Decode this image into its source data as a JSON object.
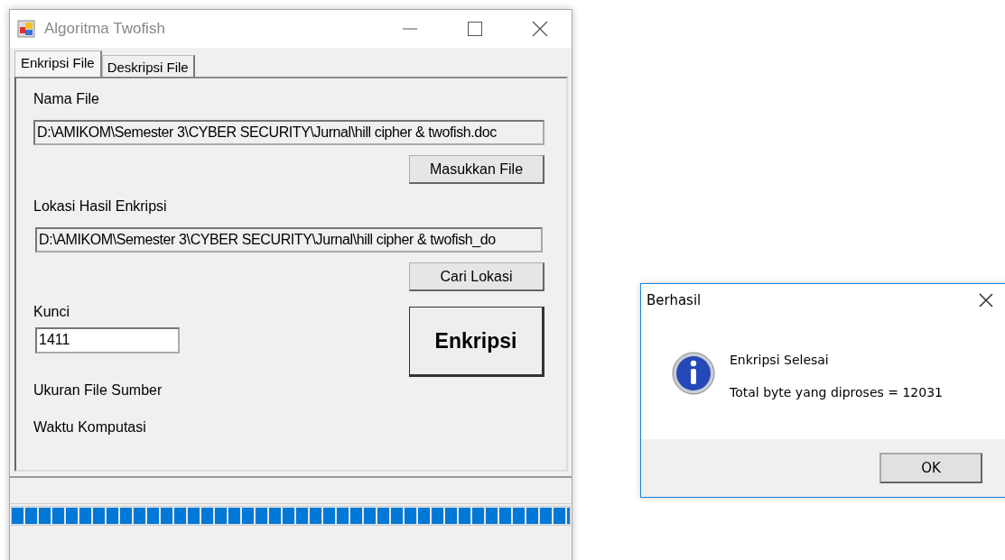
{
  "window": {
    "title": "Algoritma Twofish"
  },
  "tabs": [
    {
      "label": "Enkripsi File",
      "selected": true
    },
    {
      "label": "Deskripsi File",
      "selected": false
    }
  ],
  "form": {
    "source_label": "Nama File",
    "source_value": "D:\\AMIKOM\\Semester 3\\CYBER SECURITY\\Jurnal\\hill cipher & twofish.doc",
    "browse_button": "Masukkan File",
    "target_label": "Lokasi Hasil Enkripsi",
    "target_value": "D:\\AMIKOM\\Semester 3\\CYBER SECURITY\\Jurnal\\hill cipher & twofish_do",
    "location_button": "Cari Lokasi",
    "key_label": "Kunci",
    "key_value": "1411",
    "encrypt_button": "Enkripsi",
    "size_label": "Ukuran File Sumber",
    "time_label": "Waktu Komputasi"
  },
  "progress": {
    "level": 1
  },
  "dialog": {
    "title": "Berhasil",
    "messages": [
      "Enkripsi Selesai",
      "Total byte yang diproses = 12031"
    ],
    "button": "OK"
  }
}
